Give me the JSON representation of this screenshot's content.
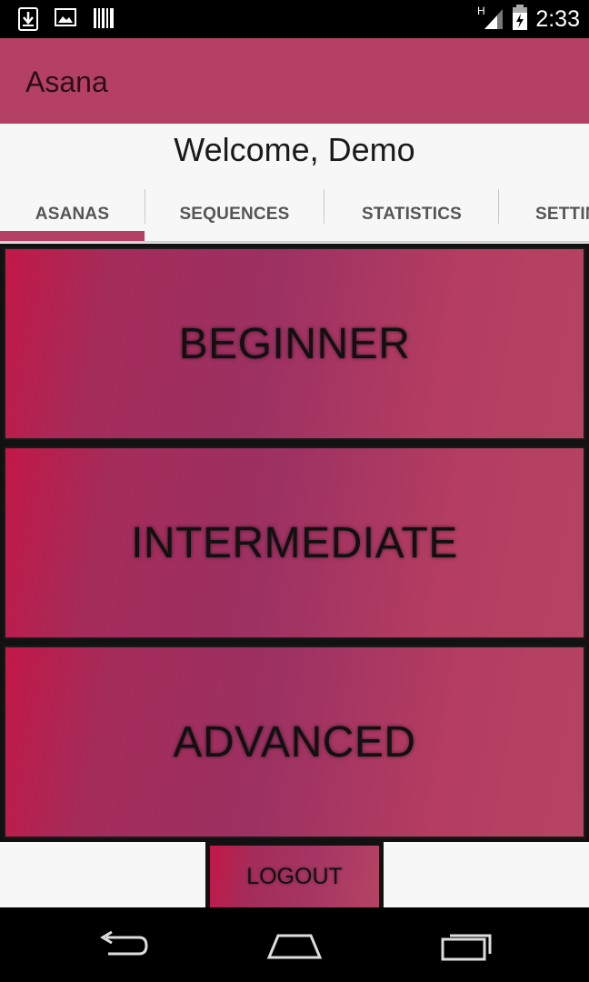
{
  "status_bar": {
    "time": "2:33",
    "network": "H",
    "icons": [
      "download-icon",
      "image-icon",
      "barcode-icon",
      "signal-icon",
      "battery-icon"
    ]
  },
  "app_bar": {
    "title": "Asana"
  },
  "welcome": "Welcome, Demo",
  "tabs": [
    {
      "label": "ASANAS",
      "selected": true
    },
    {
      "label": "SEQUENCES",
      "selected": false
    },
    {
      "label": "STATISTICS",
      "selected": false
    },
    {
      "label": "SETTINGS",
      "selected": false
    }
  ],
  "levels": [
    {
      "label": "BEGINNER"
    },
    {
      "label": "INTERMEDIATE"
    },
    {
      "label": "ADVANCED"
    }
  ],
  "logout_label": "LOGOUT",
  "nav_bar": {
    "icons": [
      "back-icon",
      "home-icon",
      "recents-icon"
    ]
  },
  "colors": {
    "accent": "#b44064",
    "gradient_start": "#c21847",
    "gradient_mid": "#9c3162",
    "gradient_end": "#b54363"
  }
}
